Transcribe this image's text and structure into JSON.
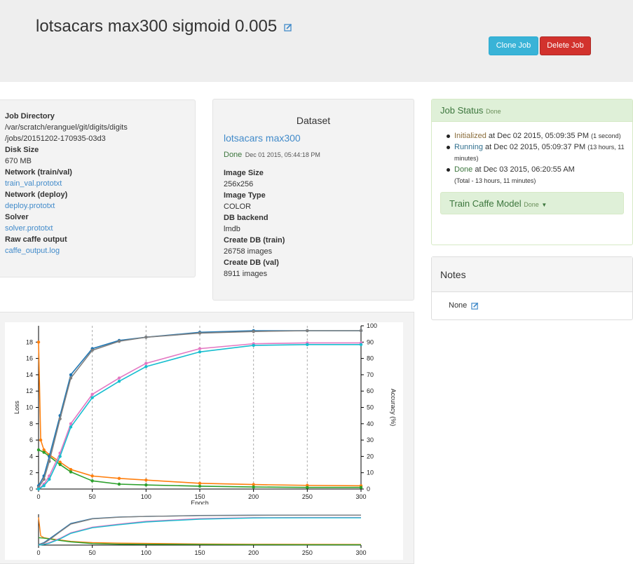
{
  "header": {
    "title": "lotsacars max300 sigmoid 0.005",
    "clone_label": "Clone Job",
    "delete_label": "Delete Job"
  },
  "job_info": {
    "items": [
      {
        "label": "Job Directory",
        "value": "/var/scratch/eranguel/git/digits/digits",
        "value2": "/jobs/20151202-170935-03d3"
      },
      {
        "label": "Disk Size",
        "value": "670 MB"
      },
      {
        "label": "Network (train/val)",
        "link": "train_val.prototxt"
      },
      {
        "label": "Network (deploy)",
        "link": "deploy.prototxt"
      },
      {
        "label": "Solver",
        "link": "solver.prototxt"
      },
      {
        "label": "Raw caffe output",
        "link": "caffe_output.log"
      }
    ]
  },
  "dataset": {
    "heading": "Dataset",
    "name": "lotsacars max300",
    "status": "Done",
    "status_time": "Dec 01 2015, 05:44:18 PM",
    "items": [
      {
        "label": "Image Size",
        "value": "256x256"
      },
      {
        "label": "Image Type",
        "value": "COLOR"
      },
      {
        "label": "DB backend",
        "value": "lmdb"
      },
      {
        "label": "Create DB (train)",
        "value": "26758 images"
      },
      {
        "label": "Create DB (val)",
        "value": "8911 images"
      }
    ]
  },
  "job_status": {
    "title": "Job Status",
    "state": "Done",
    "events": [
      {
        "status": "Initialized",
        "text": "at Dec 02 2015, 05:09:35 PM",
        "note": "(1 second)"
      },
      {
        "status": "Running",
        "text": "at Dec 02 2015, 05:09:37 PM",
        "note": "(13 hours, 11 minutes)"
      },
      {
        "status": "Done",
        "text": "at Dec 03 2015, 06:20:55 AM",
        "note": "(Total - 13 hours, 11 minutes)"
      }
    ],
    "task_label": "Train Caffe Model",
    "task_state": "Done"
  },
  "notes": {
    "title": "Notes",
    "value": "None"
  },
  "colors": {
    "accuracy_top1": "#e377c2",
    "accuracy_top5": "#17becf",
    "loss_train": "#ff7f0e",
    "loss_val": "#2ca02c",
    "accuracy_dark": "#1f77b4",
    "accuracy_gray": "#7f7f7f"
  },
  "chart_data": [
    {
      "type": "line",
      "x_label": "Epoch",
      "y_label": "Loss",
      "y2_label": "Accuracy (%)",
      "x_ticks": [
        0,
        50,
        100,
        150,
        200,
        250,
        300
      ],
      "y_ticks": [
        0,
        2,
        4,
        6,
        8,
        10,
        12,
        14,
        16,
        18
      ],
      "y2_ticks": [
        0,
        10,
        20,
        30,
        40,
        50,
        60,
        70,
        80,
        90,
        100
      ],
      "xlim": [
        0,
        300
      ],
      "ylim": [
        0,
        20
      ],
      "y2lim": [
        0,
        100
      ],
      "grid": "vertical",
      "series": [
        {
          "axis": "y",
          "color": "#ff7f0e",
          "x": [
            0,
            2,
            5,
            10,
            20,
            30,
            50,
            75,
            100,
            150,
            200,
            250,
            300
          ],
          "y": [
            18,
            6,
            4.8,
            4.2,
            3.3,
            2.4,
            1.6,
            1.3,
            1.1,
            0.7,
            0.55,
            0.45,
            0.4
          ]
        },
        {
          "axis": "y",
          "color": "#2ca02c",
          "x": [
            0,
            5,
            10,
            20,
            30,
            50,
            75,
            100,
            150,
            200,
            250,
            300
          ],
          "y": [
            4.8,
            4.5,
            4.0,
            3.0,
            2.1,
            1.0,
            0.6,
            0.5,
            0.35,
            0.25,
            0.2,
            0.2
          ]
        },
        {
          "axis": "y2",
          "color": "#1f77b4",
          "x": [
            0,
            5,
            10,
            20,
            30,
            50,
            75,
            100,
            150,
            200,
            250,
            300
          ],
          "y": [
            2,
            8,
            20,
            45,
            70,
            86,
            91,
            93,
            96,
            97,
            97,
            97
          ]
        },
        {
          "axis": "y2",
          "color": "#7f7f7f",
          "x": [
            0,
            5,
            10,
            20,
            30,
            50,
            75,
            100,
            150,
            200,
            250,
            300
          ],
          "y": [
            1,
            6,
            17,
            43,
            68,
            85,
            90.5,
            93,
            95.5,
            96.5,
            97,
            97
          ]
        },
        {
          "axis": "y2",
          "color": "#e377c2",
          "x": [
            0,
            5,
            10,
            20,
            30,
            50,
            75,
            100,
            150,
            200,
            250,
            300
          ],
          "y": [
            0,
            3,
            8,
            22,
            40,
            58,
            68,
            77,
            86,
            89,
            89.5,
            89.5
          ]
        },
        {
          "axis": "y2",
          "color": "#17becf",
          "x": [
            0,
            5,
            10,
            20,
            30,
            50,
            75,
            100,
            150,
            200,
            250,
            300
          ],
          "y": [
            0,
            2,
            6,
            20,
            38,
            56,
            66,
            75,
            84,
            88,
            88.5,
            88.5
          ]
        }
      ]
    },
    {
      "type": "line",
      "x_ticks": [
        0,
        50,
        100,
        150,
        200,
        250,
        300
      ],
      "xlim": [
        0,
        300
      ]
    }
  ]
}
